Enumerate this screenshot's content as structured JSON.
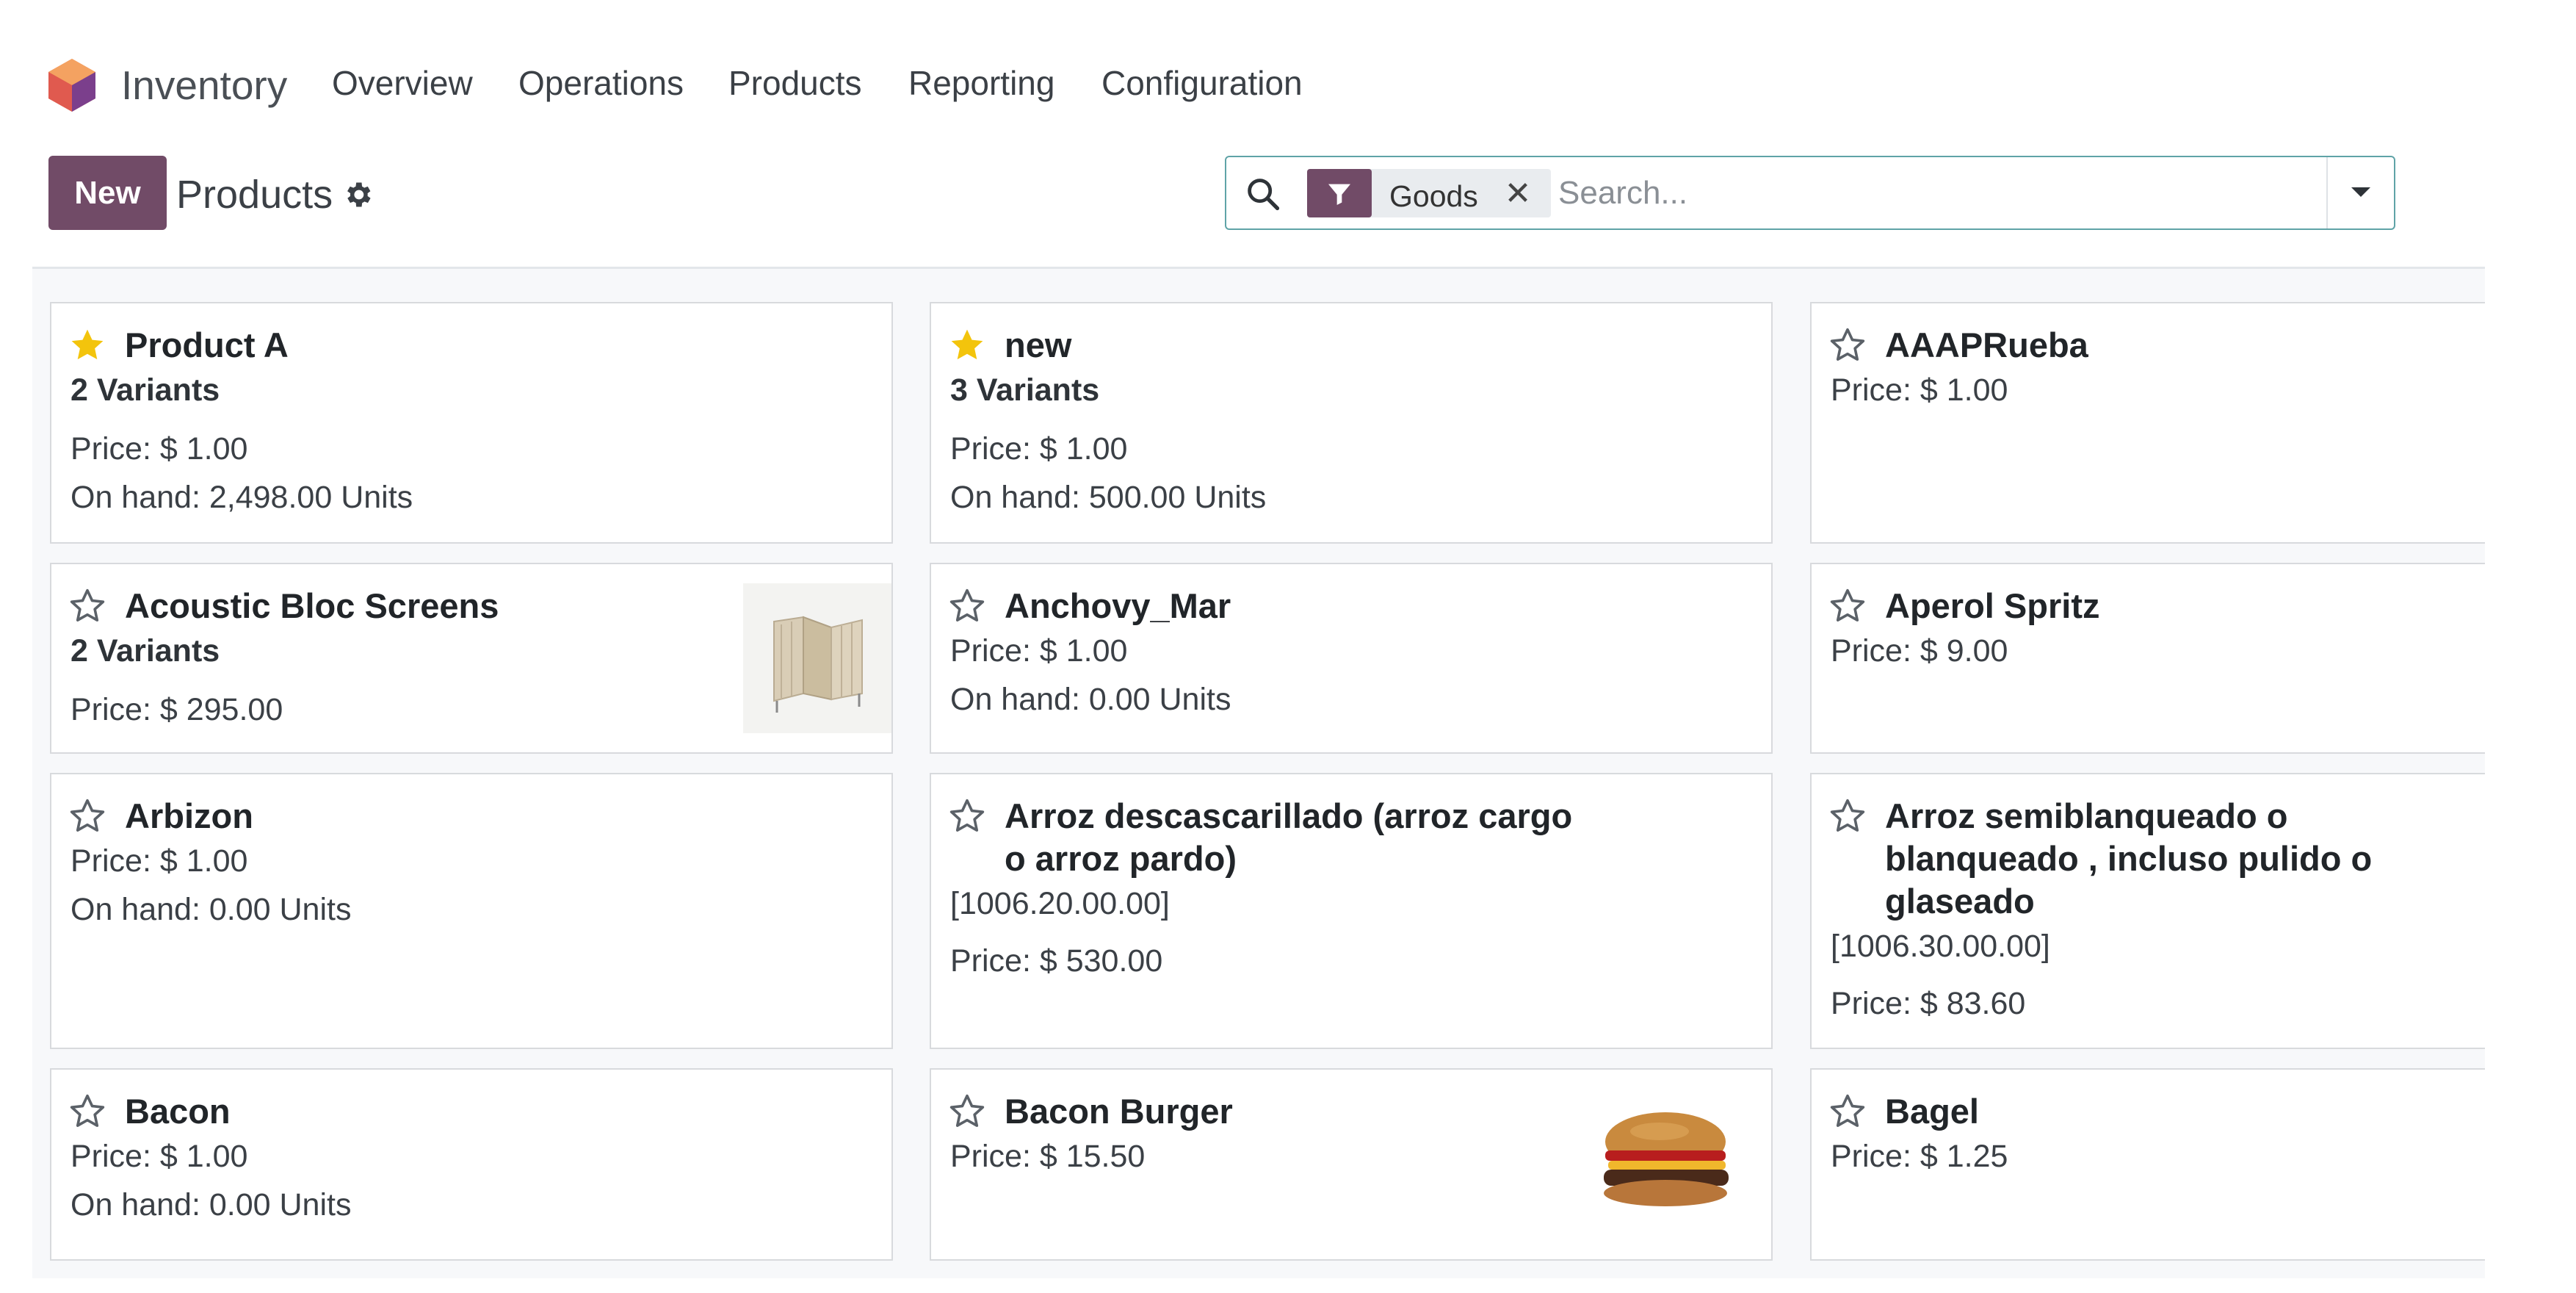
{
  "app": {
    "name": "Inventory",
    "menu": [
      "Overview",
      "Operations",
      "Products",
      "Reporting",
      "Configuration"
    ]
  },
  "control_panel": {
    "new_label": "New",
    "title": "Products",
    "facet_label": "Goods",
    "facet_remove": "✕",
    "search_placeholder": "Search..."
  },
  "colors": {
    "brand": "#714b67",
    "star_favorite": "#f3c40c",
    "star_empty": "#5b6168"
  },
  "cards": [
    {
      "title": "Product A",
      "favorite": true,
      "lines": [
        "2 Variants",
        "Price: $ 1.00",
        "On hand: 2,498.00 Units"
      ]
    },
    {
      "title": "new",
      "favorite": true,
      "lines": [
        "3 Variants",
        "Price: $ 1.00",
        "On hand: 500.00 Units"
      ]
    },
    {
      "title": "AAAPRueba",
      "favorite": false,
      "lines": [
        "Price: $ 1.00"
      ]
    },
    {
      "title": "Acoustic Bloc Screens",
      "favorite": false,
      "lines": [
        "2 Variants",
        "Price: $ 295.00"
      ],
      "image": "folding-screen-image"
    },
    {
      "title": "Anchovy_Mar",
      "favorite": false,
      "lines": [
        "Price: $ 1.00",
        "On hand: 0.00 Units"
      ]
    },
    {
      "title": "Aperol Spritz",
      "favorite": false,
      "lines": [
        "Price: $ 9.00"
      ]
    },
    {
      "title": "Arbizon",
      "favorite": false,
      "lines": [
        "Price: $ 1.00",
        "On hand: 0.00 Units"
      ]
    },
    {
      "title_lines": [
        "Arroz descascarillado (arroz cargo",
        "o arroz pardo)"
      ],
      "favorite": false,
      "lines": [
        "[1006.20.00.00]",
        "Price: $ 530.00"
      ]
    },
    {
      "title_lines": [
        "Arroz semiblanqueado o",
        "blanqueado , incluso pulido o",
        "glaseado"
      ],
      "favorite": false,
      "lines": [
        "[1006.30.00.00]",
        "Price: $ 83.60"
      ]
    },
    {
      "title": "Bacon",
      "favorite": false,
      "lines": [
        "Price: $ 1.00",
        "On hand: 0.00 Units"
      ]
    },
    {
      "title": "Bacon Burger",
      "favorite": false,
      "lines": [
        "Price: $ 15.50"
      ],
      "image": "burger-image"
    },
    {
      "title": "Bagel",
      "favorite": false,
      "lines": [
        "Price: $ 1.25"
      ]
    }
  ]
}
